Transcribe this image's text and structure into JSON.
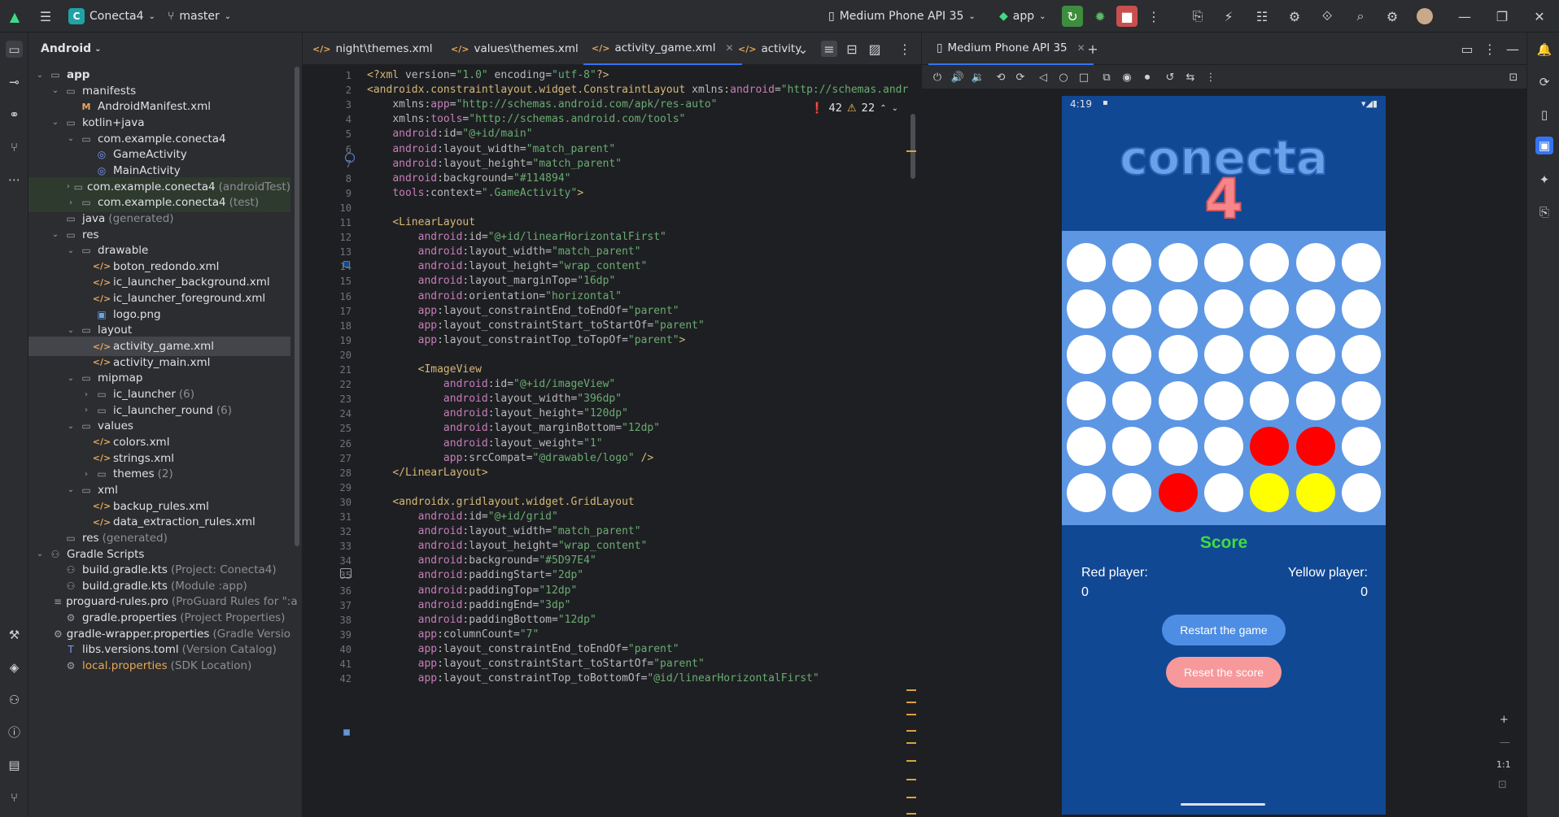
{
  "titlebar": {
    "project": "Conecta4",
    "project_initial": "C",
    "branch": "master",
    "device": "Medium Phone API 35",
    "run_config": "app"
  },
  "sidebar_left": {
    "items": [
      "folder-icon",
      "commit-icon",
      "structure-icon",
      "pull-requests-icon",
      "more-icon",
      "build-icon",
      "gradle-icon",
      "device-icon",
      "problems-icon",
      "terminal-icon",
      "git-icon"
    ]
  },
  "project_panel": {
    "view": "Android",
    "tree": [
      {
        "label": "app",
        "depth": 0,
        "chev": "v",
        "icon": "folder",
        "bold": true
      },
      {
        "label": "manifests",
        "depth": 1,
        "chev": "v",
        "icon": "folder"
      },
      {
        "label": "AndroidManifest.xml",
        "depth": 2,
        "chev": "",
        "icon": "manifest"
      },
      {
        "label": "kotlin+java",
        "depth": 1,
        "chev": "v",
        "icon": "folder"
      },
      {
        "label": "com.example.conecta4",
        "depth": 2,
        "chev": "v",
        "icon": "package"
      },
      {
        "label": "GameActivity",
        "depth": 3,
        "chev": "",
        "icon": "kt"
      },
      {
        "label": "MainActivity",
        "depth": 3,
        "chev": "",
        "icon": "kt"
      },
      {
        "label": "com.example.conecta4",
        "suffix": "(androidTest)",
        "depth": 2,
        "chev": ">",
        "icon": "package",
        "test": true
      },
      {
        "label": "com.example.conecta4",
        "suffix": "(test)",
        "depth": 2,
        "chev": ">",
        "icon": "package",
        "test": true
      },
      {
        "label": "java",
        "suffix": "(generated)",
        "depth": 1,
        "chev": "",
        "icon": "folder"
      },
      {
        "label": "res",
        "depth": 1,
        "chev": "v",
        "icon": "folder"
      },
      {
        "label": "drawable",
        "depth": 2,
        "chev": "v",
        "icon": "folder"
      },
      {
        "label": "boton_redondo.xml",
        "depth": 3,
        "chev": "",
        "icon": "xml"
      },
      {
        "label": "ic_launcher_background.xml",
        "depth": 3,
        "chev": "",
        "icon": "xml"
      },
      {
        "label": "ic_launcher_foreground.xml",
        "depth": 3,
        "chev": "",
        "icon": "xml"
      },
      {
        "label": "logo.png",
        "depth": 3,
        "chev": "",
        "icon": "img"
      },
      {
        "label": "layout",
        "depth": 2,
        "chev": "v",
        "icon": "folder"
      },
      {
        "label": "activity_game.xml",
        "depth": 3,
        "chev": "",
        "icon": "xml",
        "selected": true
      },
      {
        "label": "activity_main.xml",
        "depth": 3,
        "chev": "",
        "icon": "xml"
      },
      {
        "label": "mipmap",
        "depth": 2,
        "chev": "v",
        "icon": "folder"
      },
      {
        "label": "ic_launcher",
        "suffix": "(6)",
        "depth": 3,
        "chev": ">",
        "icon": "folder"
      },
      {
        "label": "ic_launcher_round",
        "suffix": "(6)",
        "depth": 3,
        "chev": ">",
        "icon": "folder"
      },
      {
        "label": "values",
        "depth": 2,
        "chev": "v",
        "icon": "folder"
      },
      {
        "label": "colors.xml",
        "depth": 3,
        "chev": "",
        "icon": "xml"
      },
      {
        "label": "strings.xml",
        "depth": 3,
        "chev": "",
        "icon": "xml"
      },
      {
        "label": "themes",
        "suffix": "(2)",
        "depth": 3,
        "chev": ">",
        "icon": "folder"
      },
      {
        "label": "xml",
        "depth": 2,
        "chev": "v",
        "icon": "folder"
      },
      {
        "label": "backup_rules.xml",
        "depth": 3,
        "chev": "",
        "icon": "xml"
      },
      {
        "label": "data_extraction_rules.xml",
        "depth": 3,
        "chev": "",
        "icon": "xml"
      },
      {
        "label": "res",
        "suffix": "(generated)",
        "depth": 1,
        "chev": "",
        "icon": "folder"
      },
      {
        "label": "Gradle Scripts",
        "depth": 0,
        "chev": "v",
        "icon": "gradle"
      },
      {
        "label": "build.gradle.kts",
        "suffix": "(Project: Conecta4)",
        "depth": 1,
        "chev": "",
        "icon": "gradle"
      },
      {
        "label": "build.gradle.kts",
        "suffix": "(Module :app)",
        "depth": 1,
        "chev": "",
        "icon": "gradle"
      },
      {
        "label": "proguard-rules.pro",
        "suffix": "(ProGuard Rules for \":a",
        "depth": 1,
        "chev": "",
        "icon": "file"
      },
      {
        "label": "gradle.properties",
        "suffix": "(Project Properties)",
        "depth": 1,
        "chev": "",
        "icon": "settings"
      },
      {
        "label": "gradle-wrapper.properties",
        "suffix": "(Gradle Versio",
        "depth": 1,
        "chev": "",
        "icon": "settings"
      },
      {
        "label": "libs.versions.toml",
        "suffix": "(Version Catalog)",
        "depth": 1,
        "chev": "",
        "icon": "toml"
      },
      {
        "label": "local.properties",
        "suffix": "(SDK Location)",
        "depth": 1,
        "chev": "",
        "icon": "settings",
        "warn": true
      }
    ]
  },
  "editor": {
    "tabs": [
      {
        "label": "night\\themes.xml",
        "active": false
      },
      {
        "label": "values\\themes.xml",
        "active": false
      },
      {
        "label": "activity_game.xml",
        "active": true
      },
      {
        "label": "activity",
        "active": false
      }
    ],
    "errors": "42",
    "warnings": "22",
    "lines": [
      [
        [
          "tag",
          "<?xml "
        ],
        [
          "attr",
          "version"
        ],
        [
          "plain",
          "="
        ],
        [
          "str",
          "\"1.0\""
        ],
        [
          "attr",
          " encoding"
        ],
        [
          "plain",
          "="
        ],
        [
          "str",
          "\"utf-8\""
        ],
        [
          "tag",
          "?>"
        ]
      ],
      [
        [
          "tag",
          "<androidx.constraintlayout.widget.ConstraintLayout "
        ],
        [
          "attr",
          "xmlns:"
        ],
        [
          "ns",
          "android"
        ],
        [
          "plain",
          "="
        ],
        [
          "str",
          "\"http://schemas.andr"
        ]
      ],
      [
        [
          "plain",
          "    "
        ],
        [
          "attr",
          "xmlns:"
        ],
        [
          "ns",
          "app"
        ],
        [
          "plain",
          "="
        ],
        [
          "str",
          "\"http://schemas.android.com/apk/res-auto\""
        ]
      ],
      [
        [
          "plain",
          "    "
        ],
        [
          "attr",
          "xmlns:"
        ],
        [
          "ns",
          "tools"
        ],
        [
          "plain",
          "="
        ],
        [
          "str",
          "\"http://schemas.android.com/tools\""
        ]
      ],
      [
        [
          "plain",
          "    "
        ],
        [
          "ns",
          "android"
        ],
        [
          "attr",
          ":id"
        ],
        [
          "plain",
          "="
        ],
        [
          "str",
          "\"@+id/main\""
        ]
      ],
      [
        [
          "plain",
          "    "
        ],
        [
          "ns",
          "android"
        ],
        [
          "attr",
          ":layout_width"
        ],
        [
          "plain",
          "="
        ],
        [
          "str",
          "\"match_parent\""
        ]
      ],
      [
        [
          "plain",
          "    "
        ],
        [
          "ns",
          "android"
        ],
        [
          "attr",
          ":layout_height"
        ],
        [
          "plain",
          "="
        ],
        [
          "str",
          "\"match_parent\""
        ]
      ],
      [
        [
          "plain",
          "    "
        ],
        [
          "ns",
          "android"
        ],
        [
          "attr",
          ":background"
        ],
        [
          "plain",
          "="
        ],
        [
          "str",
          "\"#114894\""
        ]
      ],
      [
        [
          "plain",
          "    "
        ],
        [
          "ns",
          "tools"
        ],
        [
          "attr",
          ":context"
        ],
        [
          "plain",
          "="
        ],
        [
          "str",
          "\".GameActivity\""
        ],
        [
          "tag",
          ">"
        ]
      ],
      [],
      [
        [
          "plain",
          "    "
        ],
        [
          "tag",
          "<LinearLayout"
        ]
      ],
      [
        [
          "plain",
          "        "
        ],
        [
          "ns",
          "android"
        ],
        [
          "attr",
          ":id"
        ],
        [
          "plain",
          "="
        ],
        [
          "str",
          "\"@+id/linearHorizontalFirst\""
        ]
      ],
      [
        [
          "plain",
          "        "
        ],
        [
          "ns",
          "android"
        ],
        [
          "attr",
          ":layout_width"
        ],
        [
          "plain",
          "="
        ],
        [
          "str",
          "\"match_parent\""
        ]
      ],
      [
        [
          "plain",
          "        "
        ],
        [
          "ns",
          "android"
        ],
        [
          "attr",
          ":layout_height"
        ],
        [
          "plain",
          "="
        ],
        [
          "str",
          "\"wrap_content\""
        ]
      ],
      [
        [
          "plain",
          "        "
        ],
        [
          "ns",
          "android"
        ],
        [
          "attr",
          ":layout_marginTop"
        ],
        [
          "plain",
          "="
        ],
        [
          "str",
          "\"16dp\""
        ]
      ],
      [
        [
          "plain",
          "        "
        ],
        [
          "ns",
          "android"
        ],
        [
          "attr",
          ":orientation"
        ],
        [
          "plain",
          "="
        ],
        [
          "str",
          "\"horizontal\""
        ]
      ],
      [
        [
          "plain",
          "        "
        ],
        [
          "ns",
          "app"
        ],
        [
          "attr",
          ":layout_constraintEnd_toEndOf"
        ],
        [
          "plain",
          "="
        ],
        [
          "str",
          "\"parent\""
        ]
      ],
      [
        [
          "plain",
          "        "
        ],
        [
          "ns",
          "app"
        ],
        [
          "attr",
          ":layout_constraintStart_toStartOf"
        ],
        [
          "plain",
          "="
        ],
        [
          "str",
          "\"parent\""
        ]
      ],
      [
        [
          "plain",
          "        "
        ],
        [
          "ns",
          "app"
        ],
        [
          "attr",
          ":layout_constraintTop_toTopOf"
        ],
        [
          "plain",
          "="
        ],
        [
          "str",
          "\"parent\""
        ],
        [
          "tag",
          ">"
        ]
      ],
      [],
      [
        [
          "plain",
          "        "
        ],
        [
          "tag",
          "<ImageView"
        ]
      ],
      [
        [
          "plain",
          "            "
        ],
        [
          "ns",
          "android"
        ],
        [
          "attr",
          ":id"
        ],
        [
          "plain",
          "="
        ],
        [
          "str",
          "\"@+id/imageView\""
        ]
      ],
      [
        [
          "plain",
          "            "
        ],
        [
          "ns",
          "android"
        ],
        [
          "attr",
          ":layout_width"
        ],
        [
          "plain",
          "="
        ],
        [
          "str",
          "\"396dp\""
        ]
      ],
      [
        [
          "plain",
          "            "
        ],
        [
          "ns",
          "android"
        ],
        [
          "attr",
          ":layout_height"
        ],
        [
          "plain",
          "="
        ],
        [
          "str",
          "\"120dp\""
        ]
      ],
      [
        [
          "plain",
          "            "
        ],
        [
          "ns",
          "android"
        ],
        [
          "attr",
          ":layout_marginBottom"
        ],
        [
          "plain",
          "="
        ],
        [
          "str",
          "\"12dp\""
        ]
      ],
      [
        [
          "plain",
          "            "
        ],
        [
          "ns",
          "android"
        ],
        [
          "attr",
          ":layout_weight"
        ],
        [
          "plain",
          "="
        ],
        [
          "str",
          "\"1\""
        ]
      ],
      [
        [
          "plain",
          "            "
        ],
        [
          "ns",
          "app"
        ],
        [
          "attr",
          ":srcCompat"
        ],
        [
          "plain",
          "="
        ],
        [
          "str",
          "\"@drawable/logo\""
        ],
        [
          "tag",
          " />"
        ]
      ],
      [
        [
          "plain",
          "    "
        ],
        [
          "tag",
          "</LinearLayout>"
        ]
      ],
      [],
      [
        [
          "plain",
          "    "
        ],
        [
          "tag",
          "<androidx.gridlayout.widget.GridLayout"
        ]
      ],
      [
        [
          "plain",
          "        "
        ],
        [
          "ns",
          "android"
        ],
        [
          "attr",
          ":id"
        ],
        [
          "plain",
          "="
        ],
        [
          "str",
          "\"@+id/grid\""
        ]
      ],
      [
        [
          "plain",
          "        "
        ],
        [
          "ns",
          "android"
        ],
        [
          "attr",
          ":layout_width"
        ],
        [
          "plain",
          "="
        ],
        [
          "str",
          "\"match_parent\""
        ]
      ],
      [
        [
          "plain",
          "        "
        ],
        [
          "ns",
          "android"
        ],
        [
          "attr",
          ":layout_height"
        ],
        [
          "plain",
          "="
        ],
        [
          "str",
          "\"wrap_content\""
        ]
      ],
      [
        [
          "plain",
          "        "
        ],
        [
          "ns",
          "android"
        ],
        [
          "attr",
          ":background"
        ],
        [
          "plain",
          "="
        ],
        [
          "str",
          "\"#5D97E4\""
        ]
      ],
      [
        [
          "plain",
          "        "
        ],
        [
          "ns",
          "android"
        ],
        [
          "attr",
          ":paddingStart"
        ],
        [
          "plain",
          "="
        ],
        [
          "str",
          "\"2dp\""
        ]
      ],
      [
        [
          "plain",
          "        "
        ],
        [
          "ns",
          "android"
        ],
        [
          "attr",
          ":paddingTop"
        ],
        [
          "plain",
          "="
        ],
        [
          "str",
          "\"12dp\""
        ]
      ],
      [
        [
          "plain",
          "        "
        ],
        [
          "ns",
          "android"
        ],
        [
          "attr",
          ":paddingEnd"
        ],
        [
          "plain",
          "="
        ],
        [
          "str",
          "\"3dp\""
        ]
      ],
      [
        [
          "plain",
          "        "
        ],
        [
          "ns",
          "android"
        ],
        [
          "attr",
          ":paddingBottom"
        ],
        [
          "plain",
          "="
        ],
        [
          "str",
          "\"12dp\""
        ]
      ],
      [
        [
          "plain",
          "        "
        ],
        [
          "ns",
          "app"
        ],
        [
          "attr",
          ":columnCount"
        ],
        [
          "plain",
          "="
        ],
        [
          "str",
          "\"7\""
        ]
      ],
      [
        [
          "plain",
          "        "
        ],
        [
          "ns",
          "app"
        ],
        [
          "attr",
          ":layout_constraintEnd_toEndOf"
        ],
        [
          "plain",
          "="
        ],
        [
          "str",
          "\"parent\""
        ]
      ],
      [
        [
          "plain",
          "        "
        ],
        [
          "ns",
          "app"
        ],
        [
          "attr",
          ":layout_constraintStart_toStartOf"
        ],
        [
          "plain",
          "="
        ],
        [
          "str",
          "\"parent\""
        ]
      ],
      [
        [
          "plain",
          "        "
        ],
        [
          "ns",
          "app"
        ],
        [
          "attr",
          ":layout_constraintTop_toBottomOf"
        ],
        [
          "plain",
          "="
        ],
        [
          "str",
          "\"@id/linearHorizontalFirst\""
        ]
      ]
    ]
  },
  "running_devices": {
    "tab_label": "Medium Phone API 35",
    "phone": {
      "time": "4:19",
      "logo_text": "conecta",
      "logo_number": "4",
      "board": [
        [
          "w",
          "w",
          "w",
          "w",
          "w",
          "w",
          "w"
        ],
        [
          "w",
          "w",
          "w",
          "w",
          "w",
          "w",
          "w"
        ],
        [
          "w",
          "w",
          "w",
          "w",
          "w",
          "w",
          "w"
        ],
        [
          "w",
          "w",
          "w",
          "w",
          "w",
          "w",
          "w"
        ],
        [
          "w",
          "w",
          "w",
          "w",
          "r",
          "r",
          "w"
        ],
        [
          "w",
          "w",
          "r",
          "w",
          "y",
          "y",
          "w"
        ]
      ],
      "score_title": "Score",
      "red_label": "Red player:",
      "red_score": "0",
      "yellow_label": "Yellow player:",
      "yellow_score": "0",
      "restart_label": "Restart the game",
      "reset_label": "Reset the score"
    },
    "zoom_label": "1:1"
  },
  "colors": {
    "accent": "#3574f0",
    "app_background": "#114894",
    "grid_background": "#5D97E4",
    "red_piece": "#ff0000",
    "yellow_piece": "#ffff00",
    "score_green": "#3fdd3f"
  }
}
